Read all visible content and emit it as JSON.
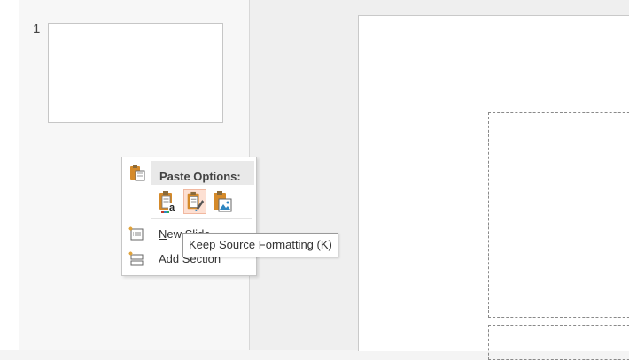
{
  "thumbnails": [
    {
      "number": "1"
    }
  ],
  "context_menu": {
    "paste_header_label": "Paste Options:",
    "paste_options": [
      {
        "icon": "paste-use-destination-theme-icon"
      },
      {
        "icon": "paste-keep-source-formatting-icon",
        "selected": true
      },
      {
        "icon": "paste-picture-icon"
      }
    ],
    "items": [
      {
        "underline": "N",
        "rest": "ew Slide",
        "icon": "new-slide-icon"
      },
      {
        "underline": "A",
        "rest": "dd Section",
        "icon": "add-section-icon"
      }
    ]
  },
  "tooltip": "Keep Source Formatting (K)",
  "colors": {
    "selection_fill": "#fde0d3",
    "selection_border": "#f1b8a0",
    "clipboard_orange": "#d58a2a"
  }
}
